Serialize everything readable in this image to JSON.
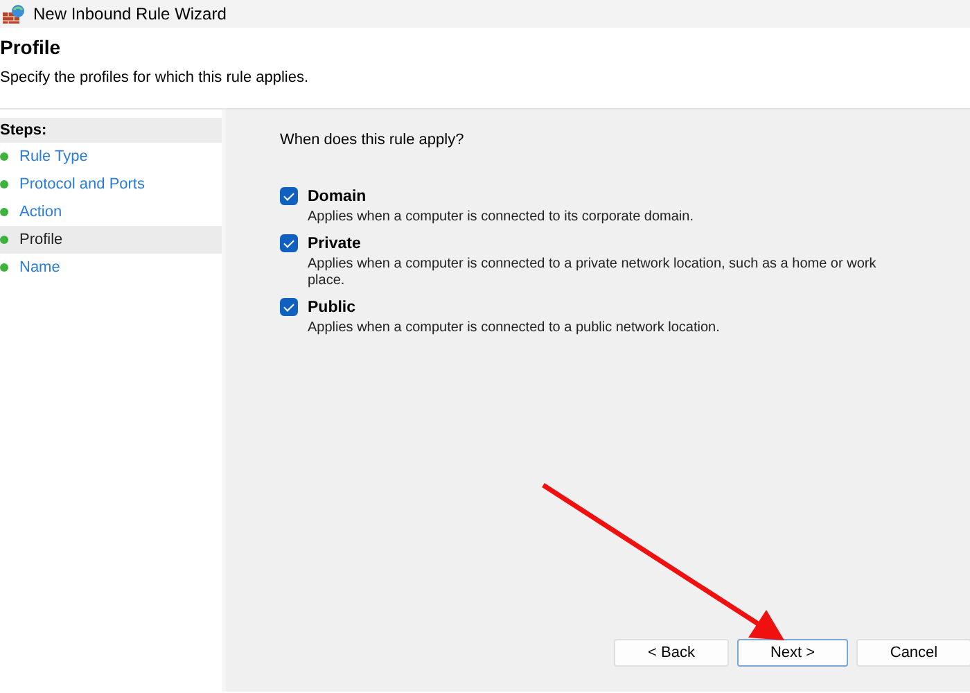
{
  "window": {
    "title": "New Inbound Rule Wizard"
  },
  "header": {
    "title": "Profile",
    "subtitle": "Specify the profiles for which this rule applies."
  },
  "steps": {
    "heading": "Steps:",
    "items": [
      {
        "label": "Rule Type",
        "selected": false
      },
      {
        "label": "Protocol and Ports",
        "selected": false
      },
      {
        "label": "Action",
        "selected": false
      },
      {
        "label": "Profile",
        "selected": true
      },
      {
        "label": "Name",
        "selected": false
      }
    ]
  },
  "question": "When does this rule apply?",
  "profiles": [
    {
      "label": "Domain",
      "description": "Applies when a computer is connected to its corporate domain.",
      "checked": true
    },
    {
      "label": "Private",
      "description": "Applies when a computer is connected to a private network location, such as a home or work place.",
      "checked": true
    },
    {
      "label": "Public",
      "description": "Applies when a computer is connected to a public network location.",
      "checked": true
    }
  ],
  "buttons": [
    {
      "label": "< Back",
      "selected": false
    },
    {
      "label": "Next >",
      "selected": true
    },
    {
      "label": "Cancel",
      "selected": false
    }
  ]
}
